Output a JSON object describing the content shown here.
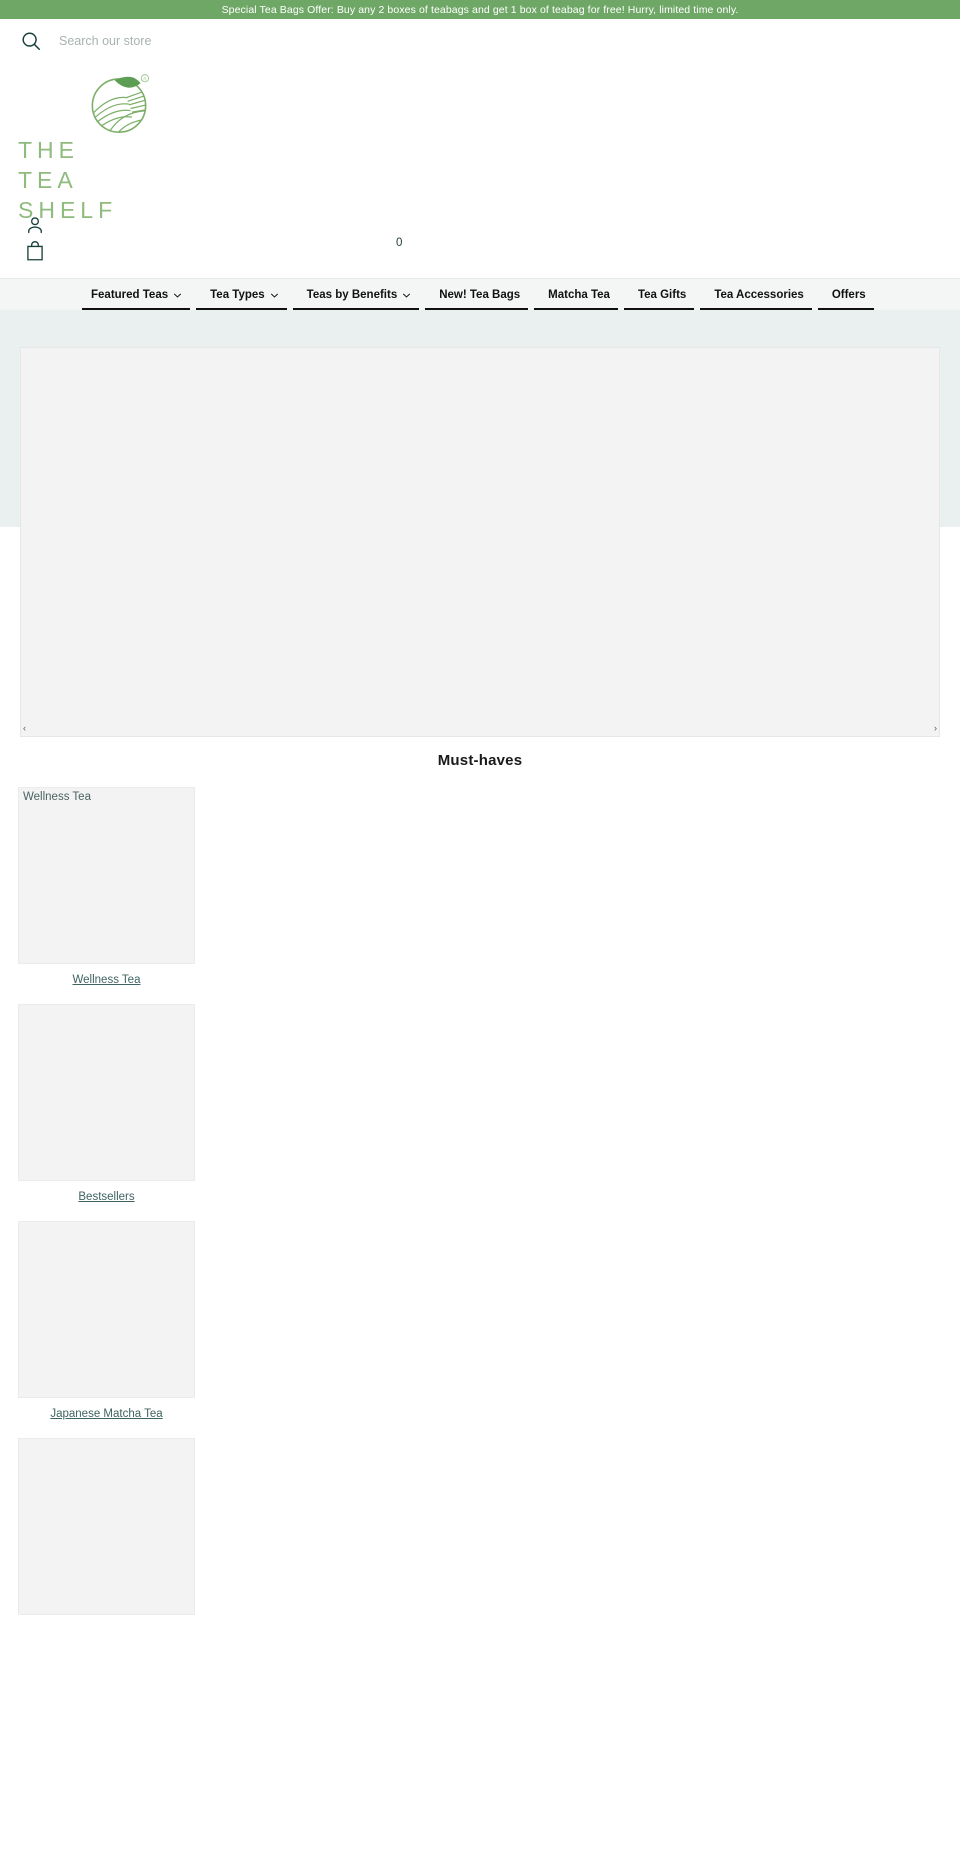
{
  "promo": {
    "text": "Special Tea Bags Offer: Buy any 2 boxes of teabags and get 1 box of teabag for free! Hurry, limited time only.",
    "background": "#6fa866"
  },
  "search": {
    "icon": "search-icon",
    "placeholder": "Search our store",
    "value": ""
  },
  "brand": {
    "logo_icon": "tea-field-emblem-logo",
    "line1": "THE",
    "line2": "TEA",
    "line3": "SHELF",
    "color": "#8fbb7e"
  },
  "header": {
    "account_icon": "user-account-icon",
    "bag_icon": "shopping-bag-icon",
    "cart_count": "0"
  },
  "nav": {
    "items": [
      {
        "label": "Featured Teas",
        "has_dropdown": true,
        "icon": "chevron-down-icon"
      },
      {
        "label": "Tea Types",
        "has_dropdown": true,
        "icon": "chevron-down-icon"
      },
      {
        "label": "Teas by Benefits",
        "has_dropdown": true,
        "icon": "chevron-down-icon"
      },
      {
        "label": "New! Tea Bags",
        "has_dropdown": false,
        "icon": ""
      },
      {
        "label": "Matcha Tea",
        "has_dropdown": false,
        "icon": ""
      },
      {
        "label": "Tea Gifts",
        "has_dropdown": false,
        "icon": ""
      },
      {
        "label": "Tea Accessories",
        "has_dropdown": false,
        "icon": ""
      },
      {
        "label": "Offers",
        "has_dropdown": false,
        "icon": ""
      }
    ]
  },
  "hero": {
    "slide_alt": "",
    "prev_label": "‹",
    "next_label": "›"
  },
  "must_haves": {
    "title": "Must-haves",
    "collections": [
      {
        "alt_text": "Wellness Tea",
        "caption": "Wellness Tea"
      },
      {
        "alt_text": "",
        "caption": "Bestsellers"
      },
      {
        "alt_text": "",
        "caption": "Japanese Matcha Tea"
      },
      {
        "alt_text": "",
        "caption": ""
      }
    ]
  }
}
